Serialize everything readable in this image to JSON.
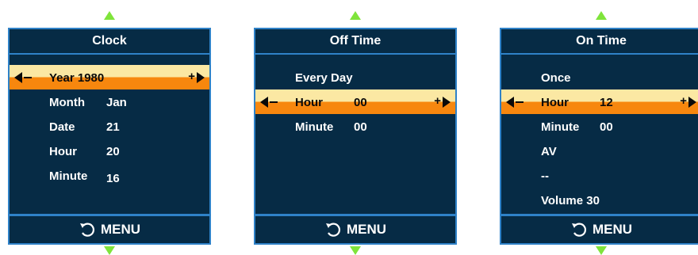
{
  "footer_label": "MENU",
  "colors": {
    "panel_bg": "#062b45",
    "border": "#2f82c8",
    "highlight_top": "#fbe8a3",
    "highlight_bottom": "#f7870e",
    "nav_arrows": "#7fe43b"
  },
  "panels": [
    {
      "title": "Clock",
      "items": [
        {
          "label": "Year 1980",
          "value": "",
          "selected": true
        },
        {
          "label": "Month",
          "value": "Jan"
        },
        {
          "label": "Date",
          "value": "21"
        },
        {
          "label": "Hour",
          "value": "20"
        },
        {
          "label": "Minute",
          "value": "16"
        }
      ]
    },
    {
      "title": "Off Time",
      "items": [
        {
          "label": "Every Day",
          "value": ""
        },
        {
          "label": "Hour",
          "value": "00",
          "selected": true
        },
        {
          "label": "Minute",
          "value": "00"
        }
      ]
    },
    {
      "title": "On Time",
      "items": [
        {
          "label": "Once",
          "value": ""
        },
        {
          "label": "Hour",
          "value": "12",
          "selected": true
        },
        {
          "label": "Minute",
          "value": "00"
        },
        {
          "label": "AV",
          "value": ""
        },
        {
          "label": "--",
          "value": ""
        },
        {
          "label": "Volume 30",
          "value": ""
        }
      ]
    }
  ]
}
